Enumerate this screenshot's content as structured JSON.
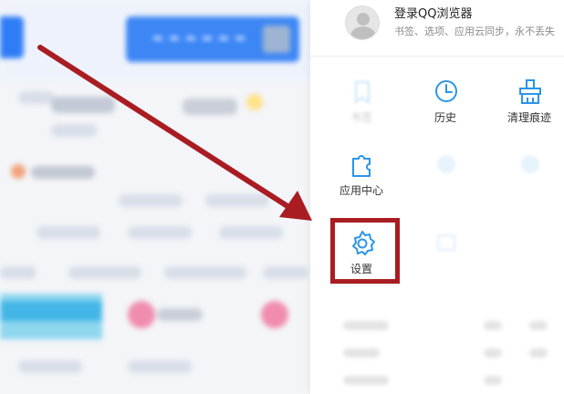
{
  "login": {
    "title": "登录QQ浏览器",
    "subtitle": "书签、选项、应用云同步，永不丢失"
  },
  "menu": {
    "row1": [
      {
        "label": "书签",
        "icon": "bookmark-icon"
      },
      {
        "label": "历史",
        "icon": "clock-icon"
      },
      {
        "label": "清理痕迹",
        "icon": "broom-icon"
      }
    ],
    "row2": [
      {
        "label": "应用中心",
        "icon": "puzzle-icon"
      }
    ],
    "row3": [
      {
        "label": "设置",
        "icon": "gear-icon"
      }
    ]
  },
  "colors": {
    "accent": "#2b95e9",
    "highlight": "#a91d22",
    "arrow": "#a91d22"
  }
}
